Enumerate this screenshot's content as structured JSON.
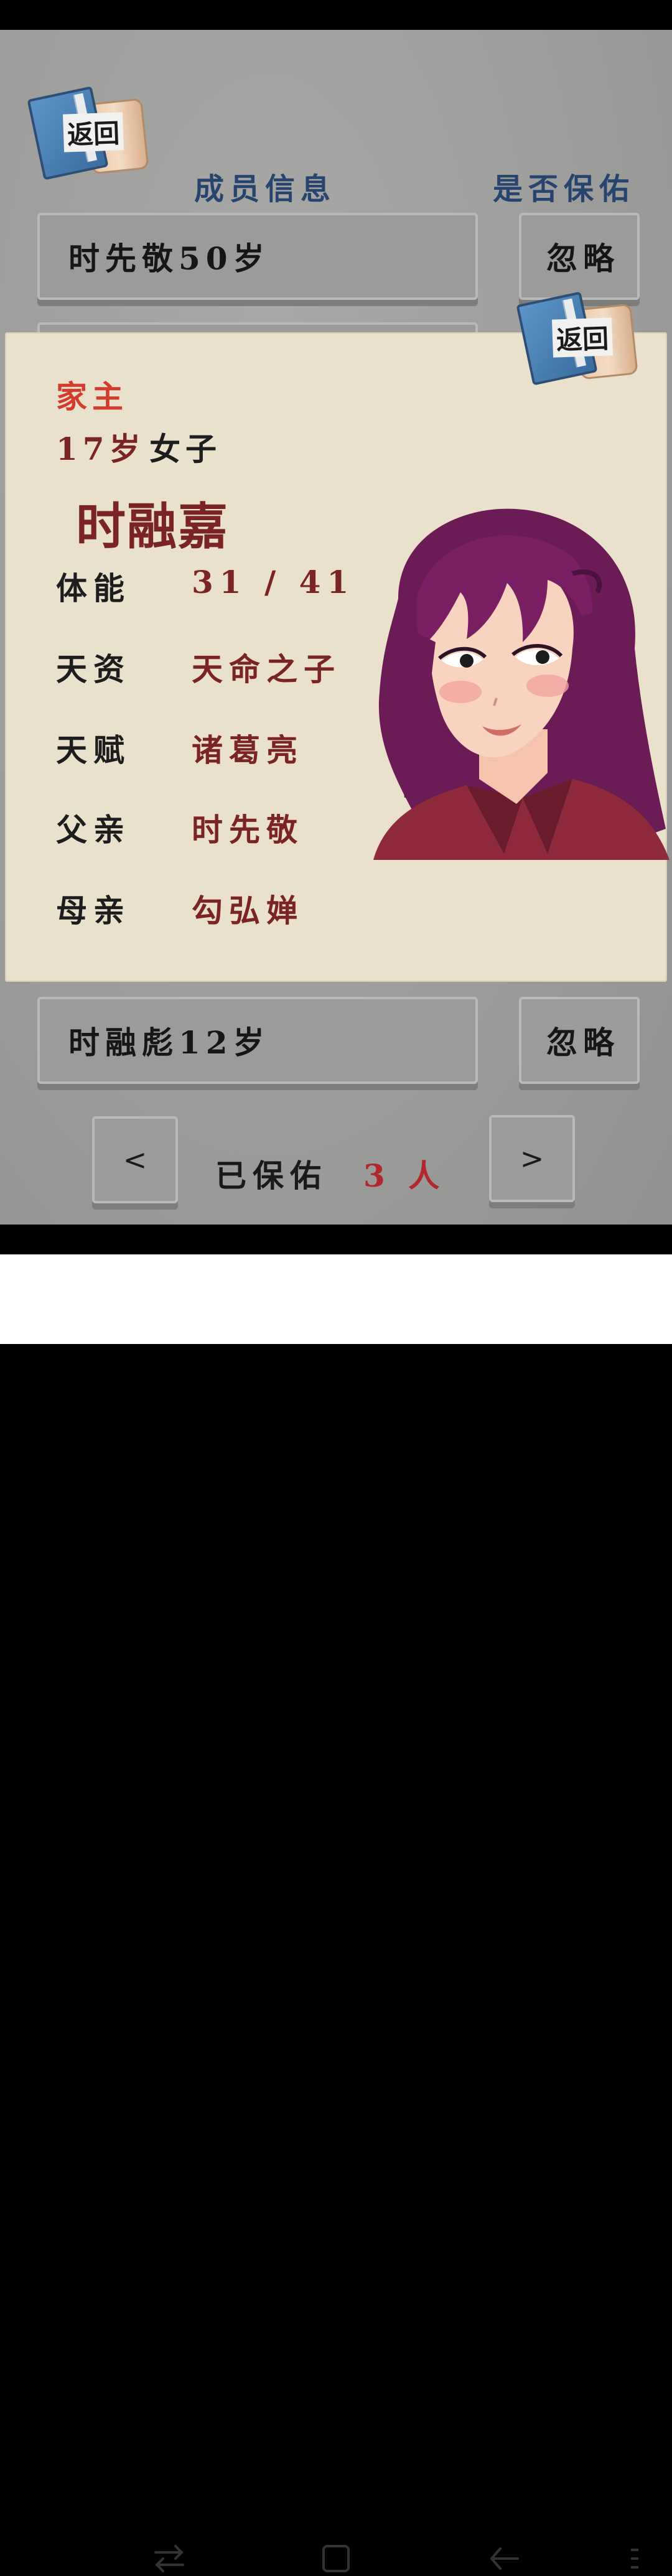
{
  "header": {
    "back_label": "返回",
    "title": "成员信息",
    "protect_question": "是否保佑"
  },
  "rows": [
    {
      "member": "时先敬50岁",
      "action": "忽略"
    },
    {
      "member": "时融彪12岁",
      "action": "忽略"
    }
  ],
  "popup": {
    "back_label": "返回",
    "role": "家主",
    "age": "17岁",
    "gender": "女子",
    "name": "时融嘉",
    "stats": [
      {
        "label": "体能",
        "value": "31 / 41"
      },
      {
        "label": "天资",
        "value": "天命之子"
      },
      {
        "label": "天赋",
        "value": "诸葛亮"
      },
      {
        "label": "父亲",
        "value": "时先敬"
      },
      {
        "label": "母亲",
        "value": "勾弘婵"
      }
    ]
  },
  "footer": {
    "prev_label": "<",
    "next_label": ">",
    "protected_label": "已保佑",
    "protected_count": "3 人"
  },
  "colors": {
    "accent_red": "#d33b2c",
    "dark_red": "#7a2424",
    "navy": "#27446e"
  }
}
